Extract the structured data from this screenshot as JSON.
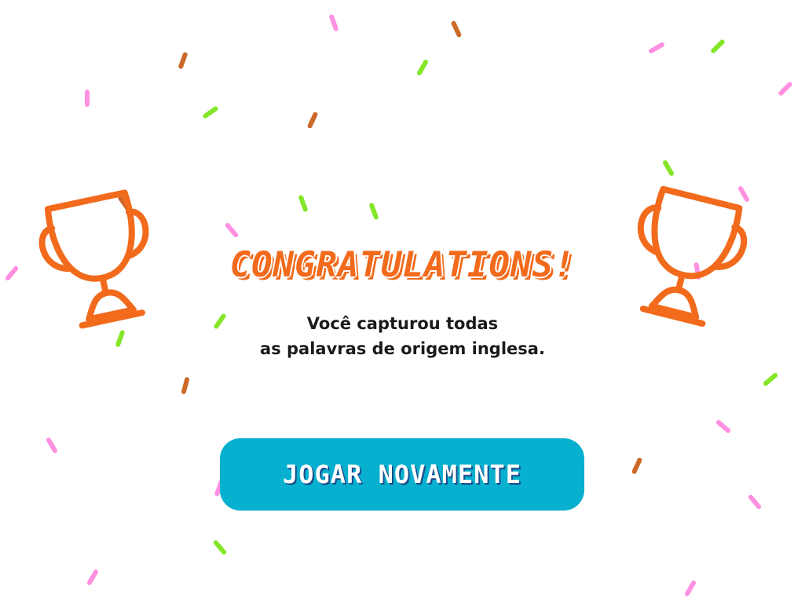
{
  "end_screen": {
    "headline": "CONGRATULATIONS!",
    "message_line1": "Você capturou todas",
    "message_line2": "as palavras de origem inglesa.",
    "play_again_label": "JOGAR NOVAMENTE"
  },
  "colors": {
    "trophy": "#f26a1b",
    "button": "#07b0cf",
    "confetti": [
      "#ff8ae0",
      "#c9611e",
      "#7de51c"
    ]
  },
  "icons": [
    "trophy-icon-left",
    "trophy-icon-right",
    "confetti"
  ]
}
